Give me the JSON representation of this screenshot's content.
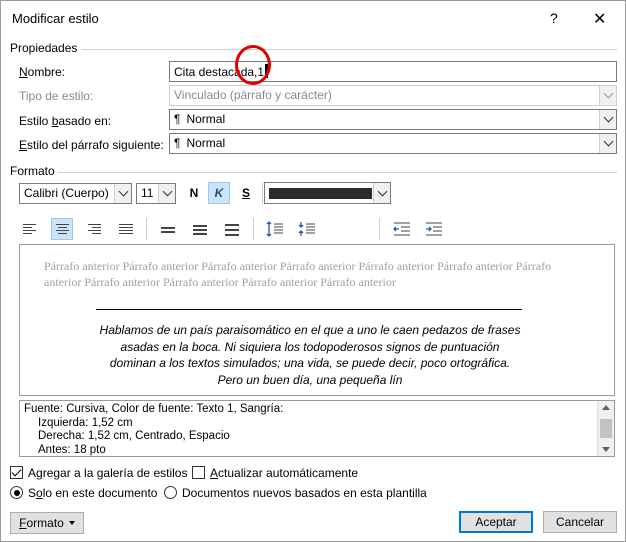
{
  "window": {
    "title": "Modificar estilo",
    "help": "?",
    "close": "✕"
  },
  "properties": {
    "group_title": "Propiedades",
    "name_label_pre": "",
    "name_label_u": "N",
    "name_label_post": "ombre:",
    "name_value": "Cita destacada,1",
    "type_label": "Tipo de estilo:",
    "type_value": "Vinculado (párrafo y carácter)",
    "based_label_pre": "Estilo ",
    "based_label_u": "b",
    "based_label_post": "asado en:",
    "based_value": "Normal",
    "next_label_pre": "",
    "next_label_u": "E",
    "next_label_post": "stilo del párrafo siguiente:",
    "next_value": "Normal",
    "para_mark": "¶"
  },
  "format": {
    "group_title": "Formato",
    "font": "Calibri (Cuerpo)",
    "size": "11",
    "bold": "N",
    "italic": "K",
    "underline": "S",
    "font_color": "#2b2b2b"
  },
  "preview": {
    "previous_paragraph": "Párrafo anterior Párrafo anterior Párrafo anterior Párrafo anterior Párrafo anterior Párrafo anterior Párrafo anterior Párrafo anterior Párrafo anterior Párrafo anterior Párrafo anterior",
    "quote_lines": [
      "Hablamos de un país paraisomático en el que a uno le caen pedazos de frases",
      "asadas en la boca. Ni siquiera los todopoderosos signos de puntuación",
      "dominan a los textos simulados; una vida, se puede decir, poco ortográfica.",
      "Pero un buen día, una pequeña lín"
    ]
  },
  "description": {
    "lines": [
      "Fuente: Cursiva, Color de fuente: Texto 1, Sangría:",
      "Izquierda:  1,52 cm",
      "Derecha:  1,52 cm, Centrado, Espacio",
      "Antes:  18 pto"
    ]
  },
  "options": {
    "add_gallery_pre": "A",
    "add_gallery_u": "g",
    "add_gallery_post": "regar a la galería de estilos",
    "add_gallery_checked": true,
    "auto_update_pre": "",
    "auto_update_u": "A",
    "auto_update_post": "ctualizar automáticamente",
    "auto_update_checked": false,
    "only_doc_pre": "S",
    "only_doc_u": "o",
    "only_doc_post": "lo en este documento",
    "new_docs_label": "Documentos nuevos basados en esta plantilla"
  },
  "buttons": {
    "format_pre": "",
    "format_u": "F",
    "format_post": "ormato",
    "accept": "Aceptar",
    "cancel": "Cancelar"
  }
}
